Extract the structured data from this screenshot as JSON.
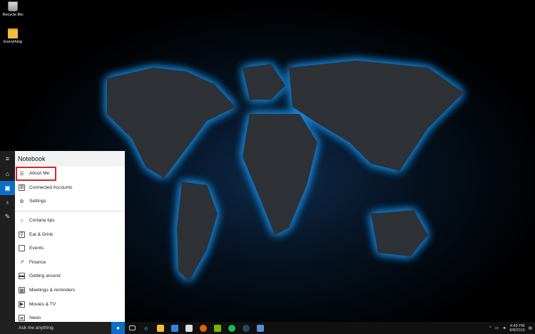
{
  "desktop": {
    "icons": [
      {
        "label": "Recycle Bin"
      },
      {
        "label": "Everything"
      }
    ]
  },
  "cortana": {
    "rail": {
      "menu_icon": "hamburger-icon",
      "items": [
        "home-icon",
        "notebook-icon",
        "reminders-icon",
        "feedback-icon"
      ]
    },
    "notebook": {
      "title": "Notebook",
      "top_items": [
        {
          "label": "About Me",
          "icon": "about-me-icon",
          "highlighted": true
        },
        {
          "label": "Connected Accounts",
          "icon": "connected-accounts-icon"
        },
        {
          "label": "Settings",
          "icon": "gear-icon"
        }
      ],
      "category_items": [
        {
          "label": "Cortana tips",
          "icon": "star-icon"
        },
        {
          "label": "Eat & Drink",
          "icon": "eat-drink-icon"
        },
        {
          "label": "Events",
          "icon": "events-icon"
        },
        {
          "label": "Finance",
          "icon": "finance-icon"
        },
        {
          "label": "Getting around",
          "icon": "getting-around-icon"
        },
        {
          "label": "Meetings & reminders",
          "icon": "meetings-icon"
        },
        {
          "label": "Movies & TV",
          "icon": "movies-icon"
        },
        {
          "label": "News",
          "icon": "news-icon"
        }
      ]
    }
  },
  "taskbar": {
    "search_placeholder": "Ask me anything",
    "apps": [
      "task-view-icon",
      "edge-icon",
      "file-explorer-icon",
      "windows-icon",
      "store-icon",
      "firefox-icon",
      "nvidia-icon",
      "spotify-icon",
      "steam-icon",
      "app-icon"
    ],
    "clock": {
      "time": "4:49 PM",
      "date": "8/8/2015"
    }
  },
  "colors": {
    "accent": "#0d6ec5",
    "highlight_box": "#d9262a",
    "glow": "#1a9cff"
  }
}
